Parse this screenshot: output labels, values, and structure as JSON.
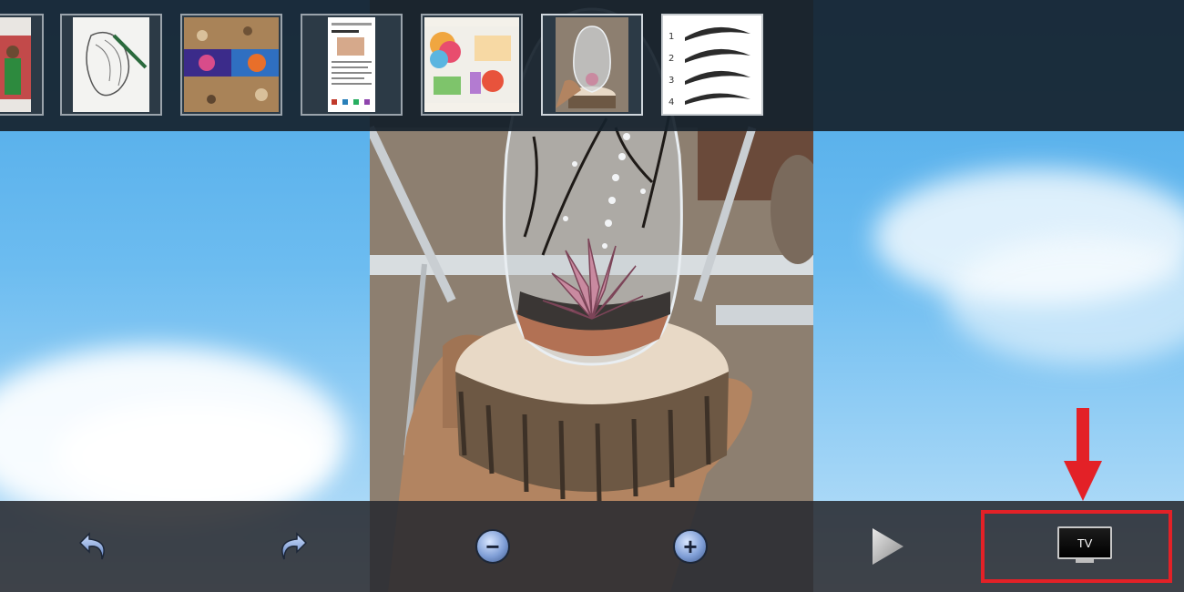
{
  "thumbnails": [
    {
      "name": "kids-photo"
    },
    {
      "name": "sketch-photo"
    },
    {
      "name": "granite-banner-photo"
    },
    {
      "name": "document-screenshot"
    },
    {
      "name": "colorful-collage"
    },
    {
      "name": "terrarium-photo"
    },
    {
      "name": "eyebrow-chart"
    }
  ],
  "thumbnail_text": {
    "eyebrow_numbers": [
      "1",
      "2",
      "3",
      "4"
    ]
  },
  "toolbar": {
    "undo_icon": "undo-icon",
    "redo_icon": "redo-icon",
    "zoom_out_symbol": "−",
    "zoom_in_symbol": "+",
    "play_icon": "play-icon",
    "tv_label": "TV"
  },
  "colors": {
    "highlight": "#e32127",
    "toolbar_bg": "#282a30",
    "strip_bg": "#16222c"
  }
}
